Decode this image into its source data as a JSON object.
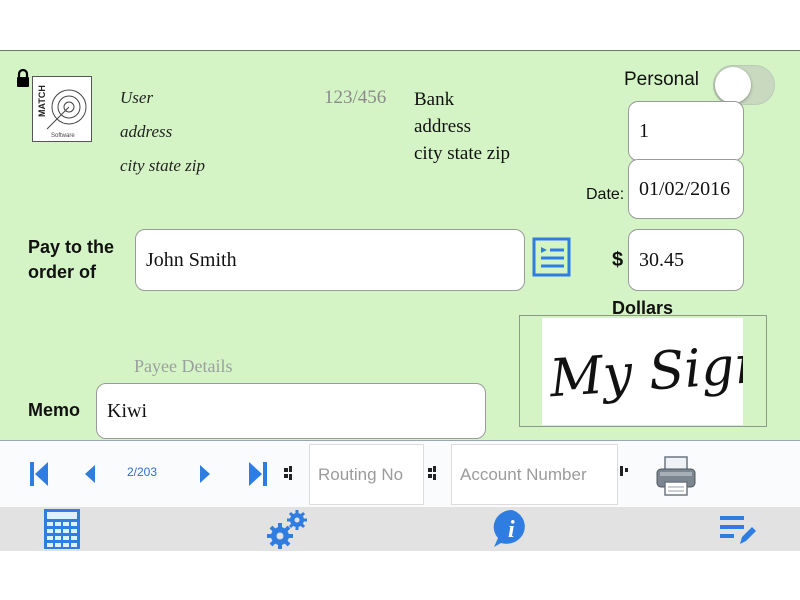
{
  "check": {
    "payer": {
      "name": "User",
      "address": "address",
      "city": "city state zip"
    },
    "check_ref": "123/456",
    "bank": {
      "name": "Bank",
      "address": "address",
      "city": "city state zip"
    },
    "personal_label": "Personal",
    "personal_on": false,
    "check_number": "1",
    "date_label": "Date:",
    "date_value": "01/02/2016",
    "pay_to_label_line1": "Pay to the",
    "pay_to_label_line2": "order of",
    "payee": "John Smith",
    "currency_symbol": "$",
    "amount": "30.45",
    "dollars_label": "Dollars",
    "payee_details_label": "Payee Details",
    "memo_label": "Memo",
    "memo_value": "Kiwi",
    "signature_text": "My Sign"
  },
  "nav": {
    "page_indicator": "2/203",
    "routing_placeholder": "Routing No",
    "account_placeholder": "Account Number"
  },
  "tabs": [
    {
      "name": "calculator-icon"
    },
    {
      "name": "settings-gears-icon"
    },
    {
      "name": "info-icon"
    },
    {
      "name": "edit-list-icon"
    }
  ],
  "colors": {
    "cheque_bg": "#d5f4c6",
    "accent_blue": "#2f7de1",
    "tab_bar": "#e2e2e2"
  }
}
